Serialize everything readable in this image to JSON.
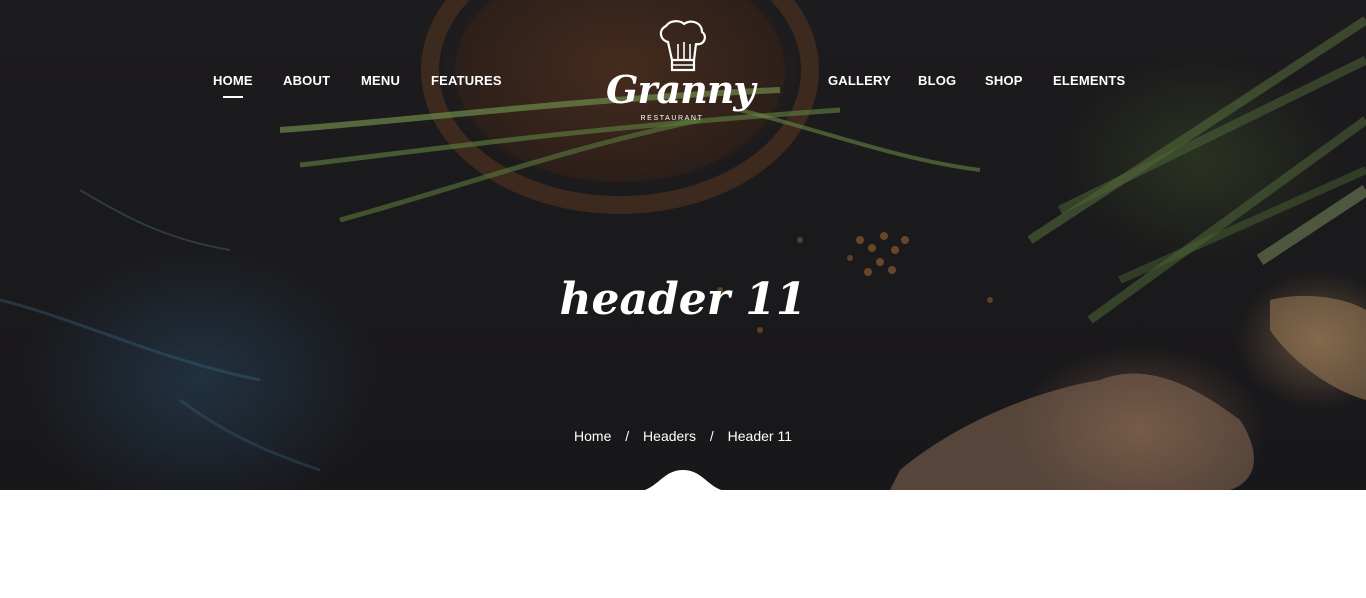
{
  "nav": {
    "left_items": [
      {
        "label": "HOME",
        "active": true
      },
      {
        "label": "ABOUT"
      },
      {
        "label": "MENU"
      },
      {
        "label": "FEATURES"
      }
    ],
    "right_items": [
      {
        "label": "GALLERY"
      },
      {
        "label": "BLOG"
      },
      {
        "label": "SHOP"
      },
      {
        "label": "ELEMENTS"
      }
    ]
  },
  "logo": {
    "name": "Granny",
    "subtitle": "RESTAURANT",
    "icon": "chef-hat-icon"
  },
  "hero": {
    "title": "header 11"
  },
  "breadcrumb": {
    "items": [
      "Home",
      "Headers",
      "Header 11"
    ],
    "separator": "/"
  },
  "colors": {
    "hero_background": "#1c1b1d",
    "text": "#ffffff",
    "content_background": "#ffffff"
  }
}
